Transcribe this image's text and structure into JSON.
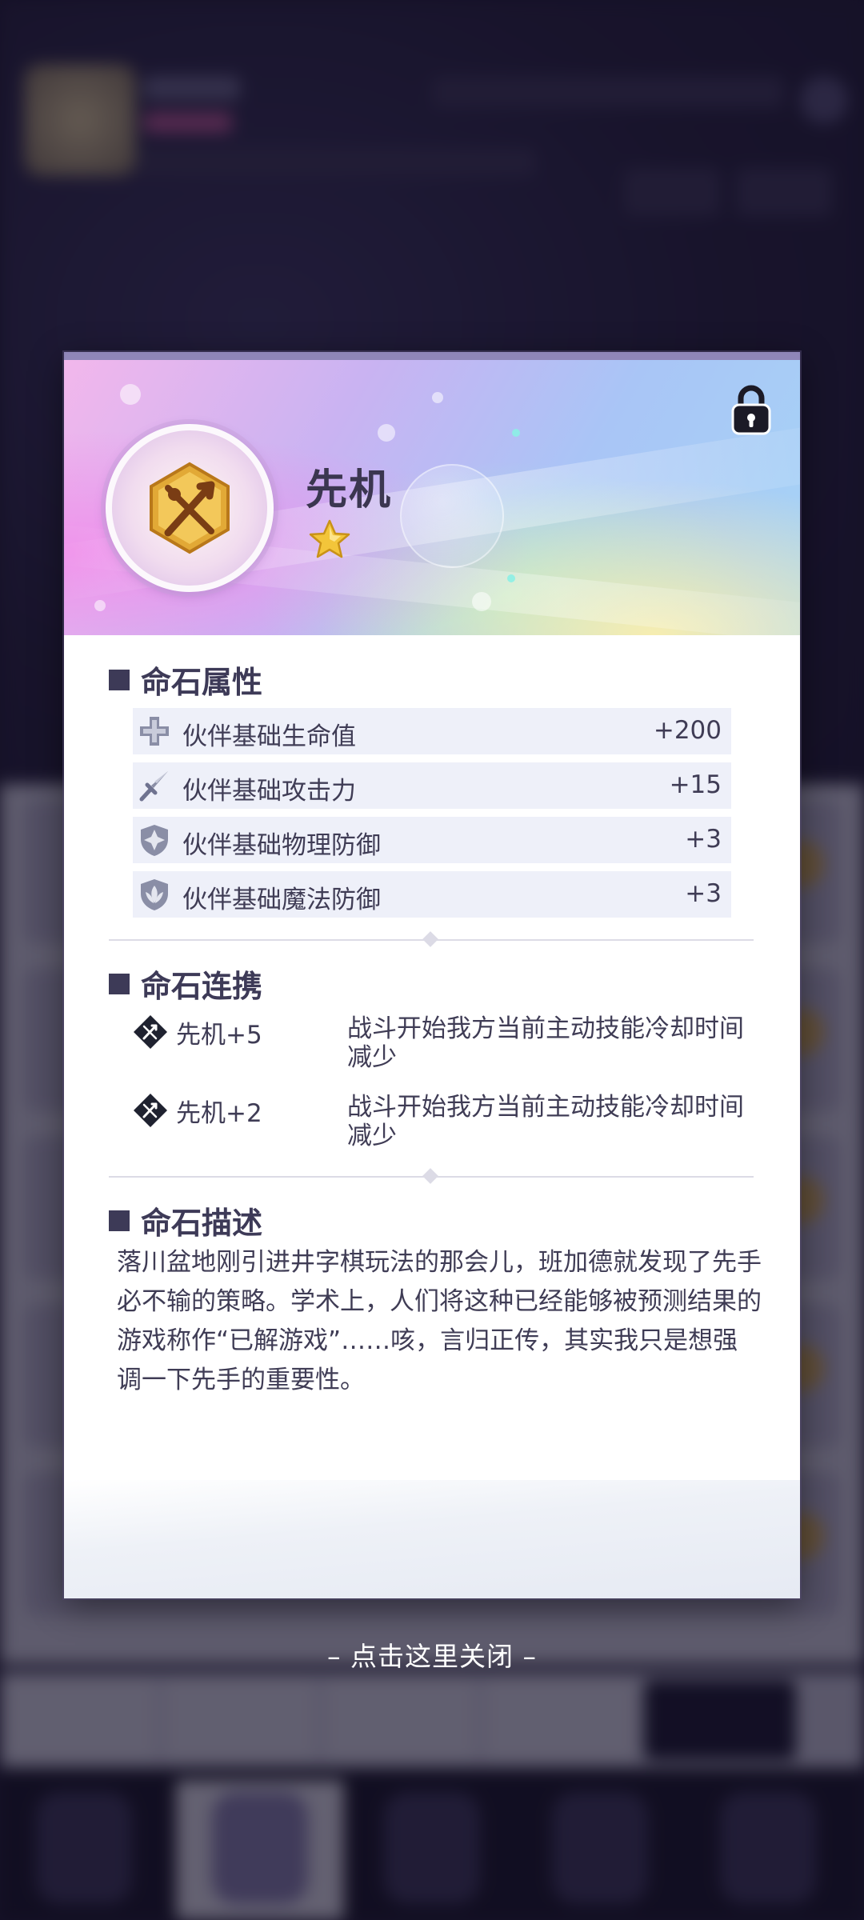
{
  "stone": {
    "name": "先机",
    "stars": 1,
    "locked": true
  },
  "attributes": {
    "title": "命石属性",
    "rows": [
      {
        "icon": "plus-icon",
        "label": "伙伴基础生命值",
        "value": "+200"
      },
      {
        "icon": "sword-icon",
        "label": "伙伴基础攻击力",
        "value": "+15"
      },
      {
        "icon": "shield-icon",
        "label": "伙伴基础物理防御",
        "value": "+3"
      },
      {
        "icon": "magic-shield-icon",
        "label": "伙伴基础魔法防御",
        "value": "+3"
      }
    ]
  },
  "combos": {
    "title": "命石连携",
    "items": [
      {
        "name": "先机+5",
        "desc": "战斗开始我方当前主动技能冷却时间减少"
      },
      {
        "name": "先机+2",
        "desc": "战斗开始我方当前主动技能冷却时间减少"
      }
    ]
  },
  "description": {
    "title": "命石描述",
    "text": "落川盆地刚引进井字棋玩法的那会儿，班加德就发现了先手必不输的策略。学术上，人们将这种已经能够被预测结果的游戏称作“已解游戏”……咳，言归正传，其实我只是想强调一下先手的重要性。"
  },
  "close_hint": "– 点击这里关闭 –",
  "colors": {
    "title_text": "#3d3a57",
    "row_bg": "#eef0f9",
    "star_gold": "#f3c53a"
  }
}
